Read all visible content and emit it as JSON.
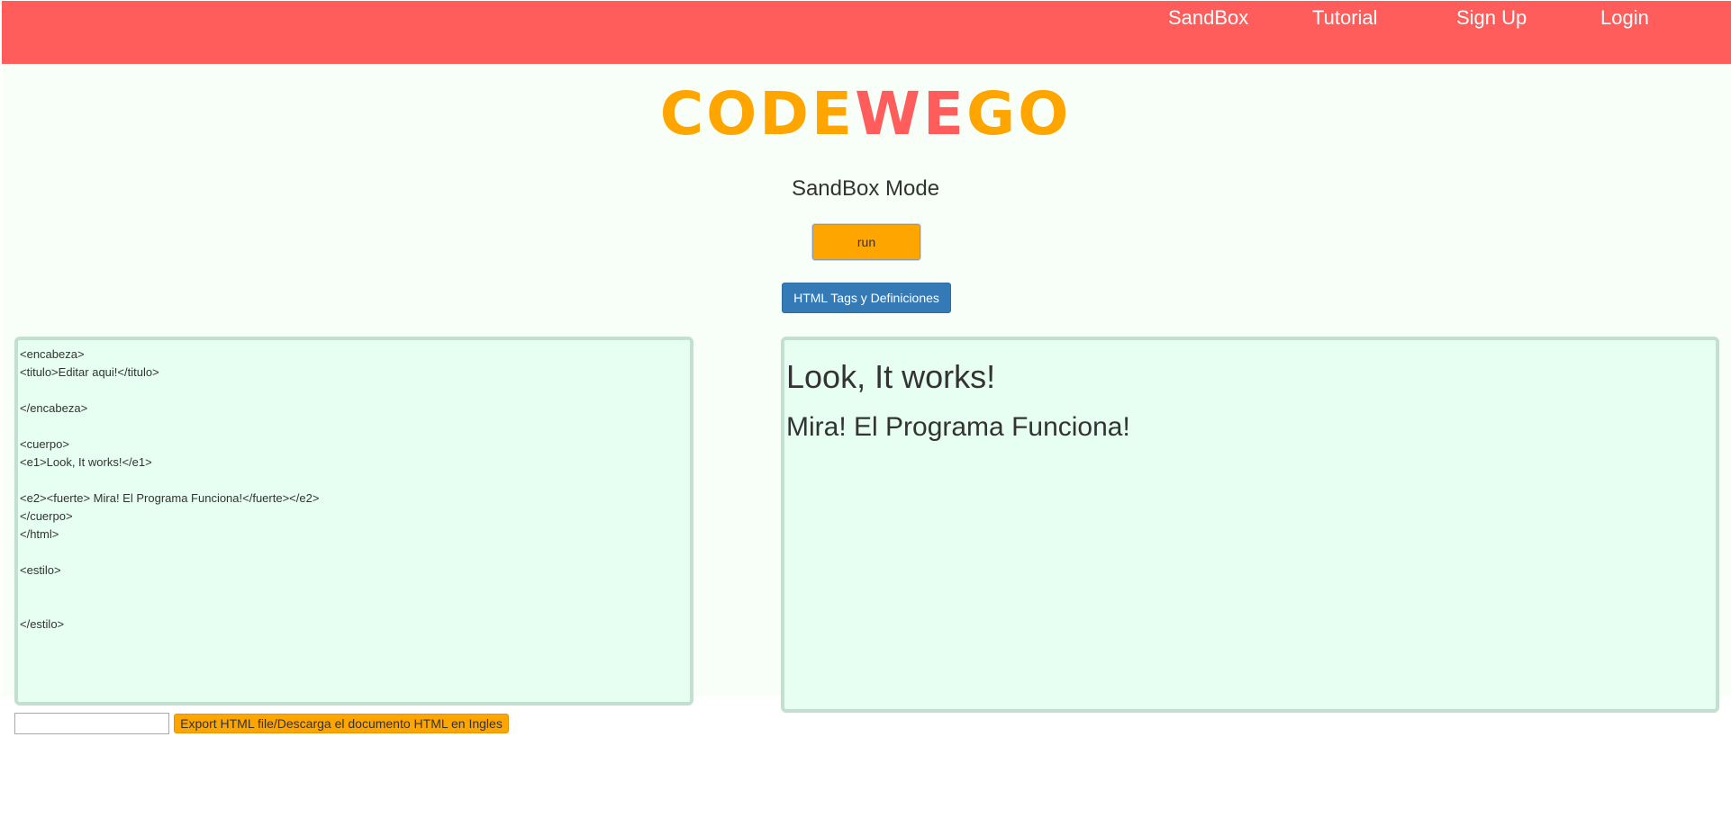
{
  "nav": {
    "items": [
      {
        "label": "SandBox"
      },
      {
        "label": "Tutorial"
      },
      {
        "label": "Sign Up"
      },
      {
        "label": "Login"
      }
    ]
  },
  "logo": {
    "part1": "CODE",
    "part2": "WE",
    "part3": "GO"
  },
  "colors": {
    "brand_red": "#ff5c5c",
    "brand_orange": "#ffa500",
    "primary_blue": "#337ab7",
    "panel_bg": "#e6fff2"
  },
  "sandbox": {
    "title": "SandBox Mode",
    "run_label": "run",
    "tags_label": "HTML Tags y Definiciones"
  },
  "editor": {
    "code": "<encabeza>\n<titulo>Editar aqui!</titulo>\n\n</encabeza>\n\n<cuerpo>\n<e1>Look, It works!</e1>\n\n<e2><fuerte> Mira! El Programa Funciona!</fuerte></e2>\n</cuerpo>\n</html>\n\n<estilo>\n\n\n</estilo>"
  },
  "output": {
    "heading1": "Look, It works!",
    "heading2": "Mira! El Programa Funciona!"
  },
  "export": {
    "input_value": "",
    "button_label": "Export HTML file/Descarga el documento HTML en Ingles"
  }
}
